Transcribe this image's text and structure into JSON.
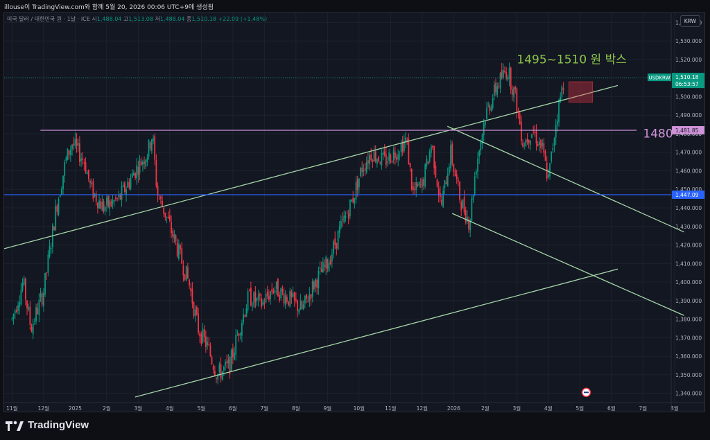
{
  "header": {
    "text": "illouse이 TradingView.com와 함께 5월 20, 2026 00:06 UTC+9에 생성됨"
  },
  "symbol_line": {
    "name": "미국 달러 / 대한민국 원 · 1날 · ICE",
    "o_label": "시",
    "o": "1,488.04",
    "h_label": "고",
    "h": "1,513.08",
    "l_label": "저",
    "l": "1,488.04",
    "c_label": "종",
    "c": "1,510.18",
    "chg": "+22.09 (+1.48%)"
  },
  "currency_button": "KRW",
  "logo_text": "TradingView",
  "chart_data": {
    "type": "candlestick",
    "y_ticks": [
      1340,
      1350,
      1360,
      1370,
      1380,
      1390,
      1400,
      1410,
      1420,
      1430,
      1440,
      1450,
      1460,
      1470,
      1480,
      1490,
      1500,
      1510,
      1520,
      1530,
      1540
    ],
    "ylim": [
      1335,
      1545
    ],
    "x_ticks": [
      "11월",
      "12월",
      "2025",
      "2월",
      "3월",
      "4월",
      "5월",
      "6월",
      "7월",
      "8월",
      "9월",
      "10월",
      "11월",
      "12월",
      "2026",
      "2월",
      "3월",
      "4월",
      "5월",
      "6월",
      "7월",
      "8월"
    ],
    "price_tags": [
      {
        "symbol": "USDKRW",
        "value": "1,510.18",
        "countdown": "06:53:57",
        "color": "#089981"
      },
      {
        "value": "1,481.85",
        "color": "#ce93d8"
      },
      {
        "value": "1,447.09",
        "color": "#2962ff"
      }
    ],
    "horizontal_lines": [
      {
        "value": 1481.85,
        "color": "#ce93d8"
      },
      {
        "value": 1447.09,
        "color": "#2962ff"
      }
    ],
    "annotations": [
      {
        "text": "1495~1510 원 박스",
        "color": "#8bc34a"
      },
      {
        "text": "1480",
        "color": "#ce93d8"
      }
    ],
    "anchor_points": [
      {
        "month": 0.0,
        "price": 1380
      },
      {
        "month": 0.35,
        "price": 1400
      },
      {
        "month": 0.6,
        "price": 1375
      },
      {
        "month": 1.0,
        "price": 1395
      },
      {
        "month": 1.4,
        "price": 1440
      },
      {
        "month": 1.7,
        "price": 1465
      },
      {
        "month": 1.9,
        "price": 1475
      },
      {
        "month": 2.3,
        "price": 1465
      },
      {
        "month": 2.5,
        "price": 1450
      },
      {
        "month": 2.9,
        "price": 1440
      },
      {
        "month": 3.4,
        "price": 1445
      },
      {
        "month": 3.9,
        "price": 1460
      },
      {
        "month": 4.3,
        "price": 1470
      },
      {
        "month": 4.45,
        "price": 1480
      },
      {
        "month": 4.6,
        "price": 1448
      },
      {
        "month": 4.9,
        "price": 1435
      },
      {
        "month": 5.3,
        "price": 1415
      },
      {
        "month": 5.6,
        "price": 1400
      },
      {
        "month": 5.9,
        "price": 1375
      },
      {
        "month": 6.2,
        "price": 1365
      },
      {
        "month": 6.5,
        "price": 1350
      },
      {
        "month": 6.9,
        "price": 1355
      },
      {
        "month": 7.2,
        "price": 1375
      },
      {
        "month": 7.5,
        "price": 1392
      },
      {
        "month": 7.9,
        "price": 1388
      },
      {
        "month": 8.3,
        "price": 1397
      },
      {
        "month": 8.7,
        "price": 1392
      },
      {
        "month": 9.2,
        "price": 1385
      },
      {
        "month": 9.6,
        "price": 1400
      },
      {
        "month": 10.0,
        "price": 1410
      },
      {
        "month": 10.4,
        "price": 1428
      },
      {
        "month": 10.8,
        "price": 1445
      },
      {
        "month": 11.1,
        "price": 1462
      },
      {
        "month": 11.4,
        "price": 1470
      },
      {
        "month": 11.8,
        "price": 1465
      },
      {
        "month": 12.2,
        "price": 1471
      },
      {
        "month": 12.5,
        "price": 1477
      },
      {
        "month": 12.7,
        "price": 1448
      },
      {
        "month": 13.0,
        "price": 1452
      },
      {
        "month": 13.3,
        "price": 1475
      },
      {
        "month": 13.6,
        "price": 1440
      },
      {
        "month": 13.9,
        "price": 1470
      },
      {
        "month": 14.2,
        "price": 1445
      },
      {
        "month": 14.5,
        "price": 1432
      },
      {
        "month": 14.7,
        "price": 1462
      },
      {
        "month": 15.0,
        "price": 1490
      },
      {
        "month": 15.4,
        "price": 1507
      },
      {
        "month": 15.7,
        "price": 1515
      },
      {
        "month": 15.95,
        "price": 1500
      },
      {
        "month": 16.2,
        "price": 1475
      },
      {
        "month": 16.5,
        "price": 1482
      },
      {
        "month": 16.8,
        "price": 1472
      },
      {
        "month": 17.0,
        "price": 1455
      },
      {
        "month": 17.25,
        "price": 1488
      },
      {
        "month": 17.5,
        "price": 1510
      }
    ]
  }
}
